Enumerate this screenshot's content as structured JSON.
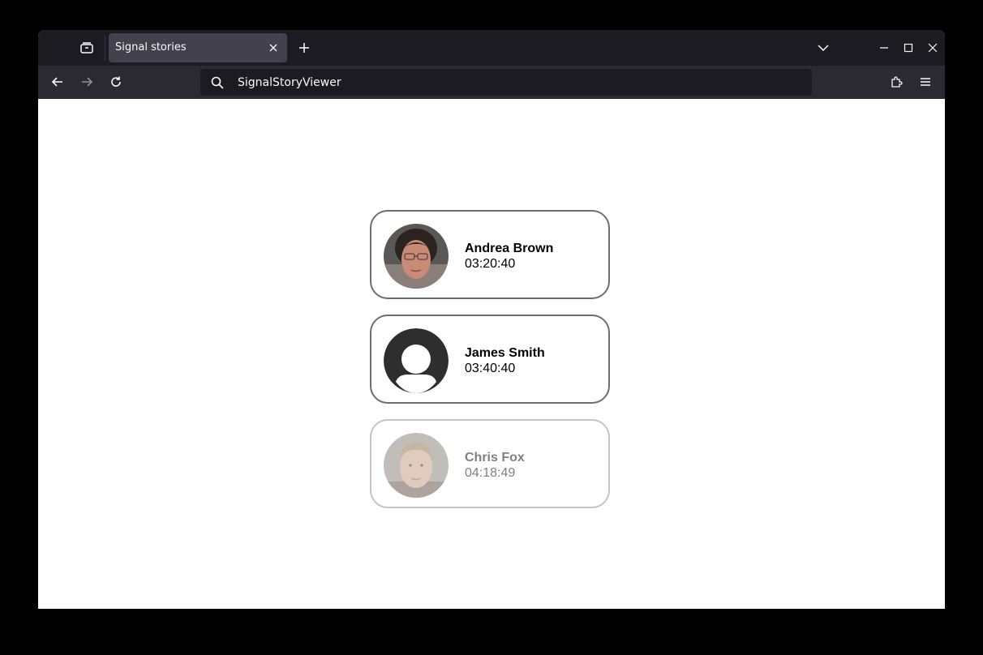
{
  "browser": {
    "tab_title": "Signal stories",
    "url": "SignalStoryViewer"
  },
  "stories": [
    {
      "name": "Andrea Brown",
      "time": "03:20:40",
      "avatar": "photo",
      "viewed": false
    },
    {
      "name": "James Smith",
      "time": "03:40:40",
      "avatar": "default-person",
      "viewed": false
    },
    {
      "name": "Chris Fox",
      "time": "04:18:49",
      "avatar": "photo",
      "viewed": true
    }
  ],
  "colors": {
    "chrome_dark": "#1c1b22",
    "toolbar": "#2b2a33",
    "tab_active": "#42414d",
    "card_border": "#6e6e6e",
    "card_border_viewed": "#c4c4c4",
    "text_viewed": "#808080"
  }
}
